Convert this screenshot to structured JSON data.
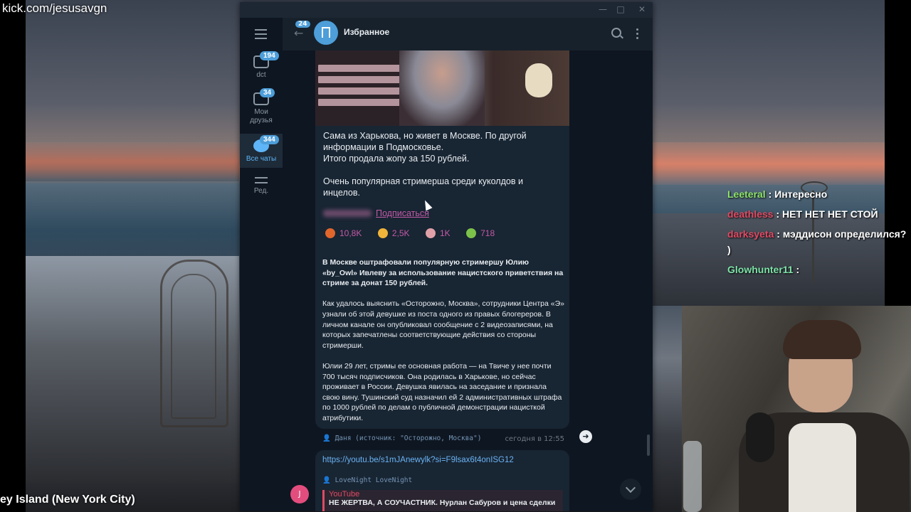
{
  "stream": {
    "url_label": "kick.com/jesusavgn",
    "location_label": "ey Island (New York City)"
  },
  "overlay_chat": [
    {
      "user": "Leeteral",
      "text": ": Интересно"
    },
    {
      "user": "deathless",
      "text": ": НЕТ НЕТ НЕТ СТОЙ"
    },
    {
      "user": "darksyeta",
      "text": ": мэддисон определился? )"
    },
    {
      "user": "Glowhunter11",
      "text": ":"
    }
  ],
  "sidebar": {
    "folders": [
      {
        "label": "dct",
        "badge": "194"
      },
      {
        "label": "Мои друзья",
        "badge": "34"
      },
      {
        "label": "Все чаты",
        "badge": "344"
      },
      {
        "label": "Ред.",
        "badge": ""
      }
    ]
  },
  "header": {
    "back_badge": "24",
    "title": "Избранное"
  },
  "post": {
    "paragraphs": [
      "Сама из Харькова, но живет в Москве. По другой информации в Подмосковье.",
      "Итого продала жопу за 150 рублей.",
      "Очень популярная стримерша среди куколдов и инцелов."
    ],
    "subscribe": "Подписаться",
    "reactions": [
      {
        "count": "10,8K",
        "color": "#e0662c"
      },
      {
        "count": "2,5K",
        "color": "#f0b43a"
      },
      {
        "count": "1K",
        "color": "#e0a0a8"
      },
      {
        "count": "718",
        "color": "#7cc24a"
      }
    ]
  },
  "news": {
    "headline": "В Москве оштрафовали популярную стримершу Юлию «by_Owl» Ивлеву за использование нацистского приветствия на стриме за донат 150 рублей.",
    "p1": "Как удалось выяснить «Осторожно, Москва», сотрудники Центра «Э» узнали об этой девушке из поста одного из правых блогереров. В личном канале он опубликовал сообщение с 2 видеозаписями, на которых запечатлены соответствующие действия со стороны стримерши.",
    "p2": "Юлии 29 лет, стримы ее основная работа — на Твиче у нее почти 700 тысяч подписчиков. Она родилась в Харькове, но сейчас проживает в России. Девушка явилась на заседание и признала свою вину. Тушинский суд назначил ей 2 административных штрафа по 1000 рублей по делам о публичной демонстрации нацисткой атрибутики.",
    "source": "Даня (источник: \"Осторожно, Москва\")",
    "time": "сегодня в 12:55"
  },
  "link_message": {
    "url": "https://youtu.be/s1mJAnewylk?si=F9lsax6t4onISG12",
    "from": "LoveNight LoveNight",
    "preview_site": "YouTube",
    "preview_title": "НЕ ЖЕРТВА, А СОУЧАСТНИК. Нурлан Сабуров и цена сделки",
    "sender_initial": "J"
  },
  "colors": {
    "accent": "#4d9ed9",
    "link": "#6ab3f3",
    "reaction_text": "#c25aa6",
    "bubble": "#182533",
    "sidebar_bg": "#0e1621"
  }
}
